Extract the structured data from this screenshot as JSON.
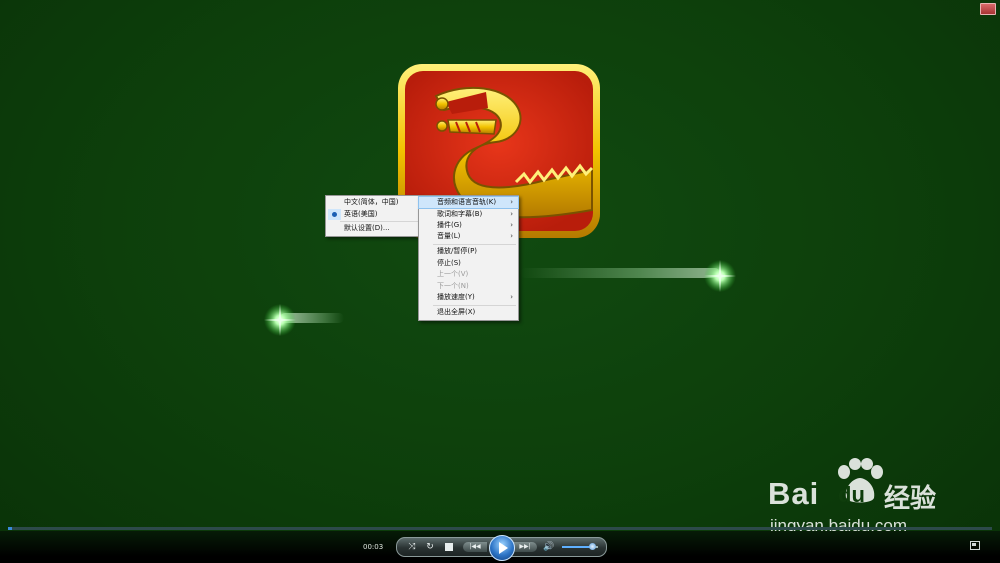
{
  "context_menu": {
    "items": [
      {
        "label": "音频和语言音轨(K)",
        "has_submenu": true,
        "highlighted": true
      },
      {
        "label": "歌词和字幕(B)",
        "has_submenu": true
      },
      {
        "label": "播件(G)",
        "has_submenu": true
      },
      {
        "label": "音量(L)",
        "has_submenu": true
      },
      {
        "label": "播放/暂停(P)"
      },
      {
        "label": "停止(S)"
      },
      {
        "label": "上一个(V)",
        "disabled": true
      },
      {
        "label": "下一个(N)",
        "disabled": true
      },
      {
        "label": "播放速度(Y)",
        "has_submenu": true
      },
      {
        "label": "退出全屏(X)"
      }
    ],
    "arrow": "›"
  },
  "submenu": {
    "items": [
      {
        "label": "中文(简体，中国)",
        "selected": false
      },
      {
        "label": "英语(美国)",
        "selected": true
      },
      {
        "label": "默认设置(D)..."
      }
    ]
  },
  "player": {
    "time": "00:03",
    "progress": 0.004,
    "volume": 0.83,
    "prev_label": "|◀◀",
    "next_label": "▶▶|"
  },
  "watermark": {
    "brand": "Bai",
    "brand_suffix": "du",
    "cn": "经验",
    "url": "jingyan.baidu.com"
  },
  "colors": {
    "background": "#0f3d0c",
    "logo_red": "#d62a12",
    "logo_gold": "#f2c200",
    "menu_highlight": "#cfe6fb"
  }
}
